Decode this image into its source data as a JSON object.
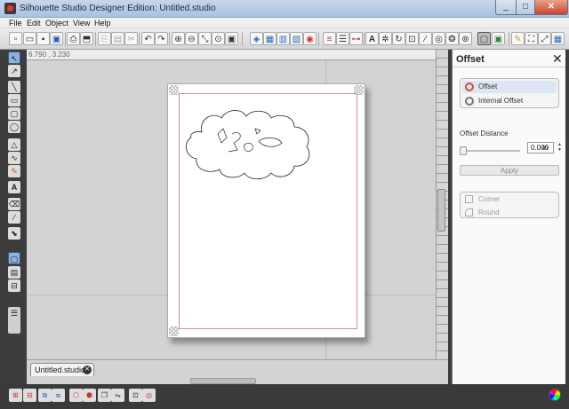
{
  "window": {
    "title": "Silhouette Studio Designer Edition: Untitled.studio"
  },
  "menu": [
    "File",
    "Edit",
    "Object",
    "View",
    "Help"
  ],
  "toolbar": {
    "icons": [
      "new-icon",
      "open-icon",
      "save-icon",
      "save-library-icon",
      "print-icon",
      "cut-send-icon",
      "copy-icon",
      "paste-icon",
      "cut-icon",
      "undo-icon",
      "redo-icon",
      "zoom-in-icon",
      "zoom-out-icon",
      "zoom-drag-icon",
      "fit-page-icon",
      "fill-color-icon",
      "fill-gradient-icon",
      "fill-pattern-icon",
      "line-color-icon",
      "line-style-icon",
      "line-width-icon",
      "text-style-icon",
      "replicate-icon",
      "rotate-icon",
      "scale-icon",
      "knife-icon",
      "offset-icon",
      "trace-icon",
      "active-panel-icon",
      "eraser-icon",
      "trace-area-icon",
      "library-icon"
    ]
  },
  "canvas": {
    "coordinates": "6.790 , 3.230",
    "tab_label": "Untitled.studio"
  },
  "panel": {
    "title": "Offset",
    "options": [
      {
        "label": "Offset",
        "selected": true,
        "icon": "offset-icon",
        "color": "#d64a3a"
      },
      {
        "label": "Internal Offset",
        "selected": false,
        "icon": "internal-offset-icon",
        "color": "#6a6a6a"
      }
    ],
    "distance_label": "Offset Distance",
    "distance_value": "0.000",
    "distance_slider_fraction": 0,
    "unit": "in",
    "apply_label": "Apply",
    "corner_options": [
      "Corner",
      "Round"
    ]
  },
  "colors": {
    "accent": "#d64a3a",
    "registration": "#e08a8a"
  }
}
